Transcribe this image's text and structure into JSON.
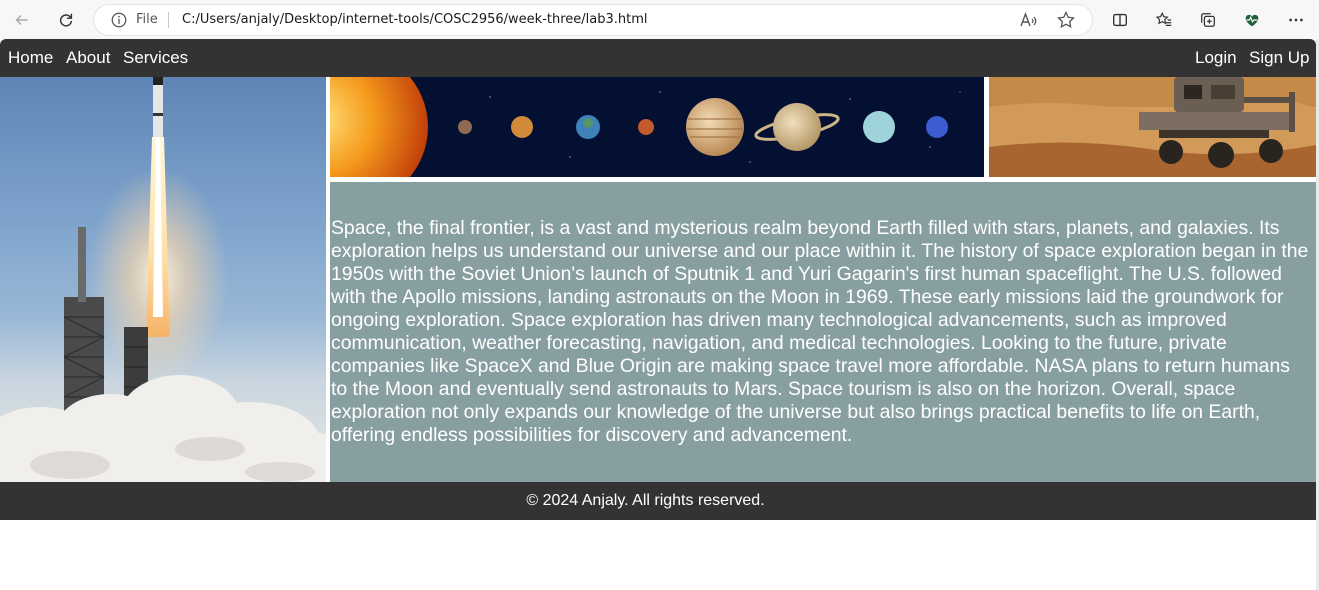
{
  "browser": {
    "file_label": "File",
    "url": "C:/Users/anjaly/Desktop/internet-tools/COSC2956/week-three/lab3.html",
    "icons": [
      "back-icon",
      "refresh-icon",
      "info-icon",
      "read-aloud-icon",
      "favorite-star-icon",
      "split-screen-icon",
      "favorites-icon",
      "collections-icon",
      "performance-icon",
      "more-icon"
    ]
  },
  "nav": {
    "home": "Home",
    "about": "About",
    "services": "Services",
    "login": "Login",
    "signup": "Sign Up"
  },
  "content": {
    "paragraph": "Space, the final frontier, is a vast and mysterious realm beyond Earth filled with stars, planets, and galaxies. Its exploration helps us understand our universe and our place within it. The history of space exploration began in the 1950s with the Soviet Union's launch of Sputnik 1 and Yuri Gagarin's first human spaceflight. The U.S. followed with the Apollo missions, landing astronauts on the Moon in 1969. These early missions laid the groundwork for ongoing exploration. Space exploration has driven many technological advancements, such as improved communication, weather forecasting, navigation, and medical technologies. Looking to the future, private companies like SpaceX and Blue Origin are making space travel more affordable. NASA plans to return humans to the Moon and eventually send astronauts to Mars. Space tourism is also on the horizon. Overall, space exploration not only expands our knowledge of the universe but also brings practical benefits to life on Earth, offering endless possibilities for discovery and advancement."
  },
  "footer": {
    "text": "© 2024 Anjaly. All rights reserved."
  },
  "colors": {
    "nav_bg": "#333333",
    "content_bg": "#889fa2",
    "text": "#ffffff"
  }
}
